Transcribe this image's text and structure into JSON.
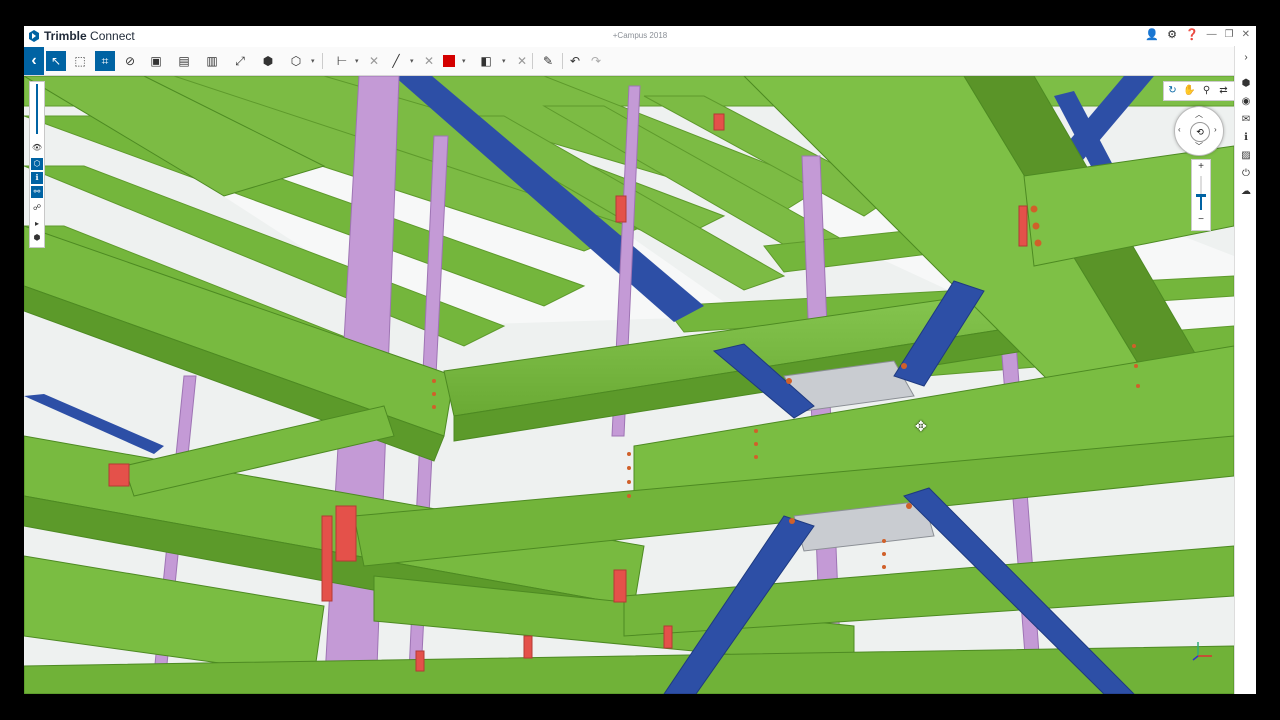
{
  "app": {
    "brand_bold": "Trimble",
    "brand_rest": " Connect",
    "document_title": "+Campus 2018"
  },
  "titlebar_icons": [
    "user-icon",
    "gear-icon",
    "help-icon",
    "minimize-icon",
    "restore-icon",
    "close-icon"
  ],
  "toolbar": {
    "tools": [
      {
        "name": "select-tool",
        "glyph": "↖",
        "active": true
      },
      {
        "name": "box-select-tool",
        "glyph": "⬚",
        "active": false
      },
      {
        "name": "multi-select-tool",
        "glyph": "⌗",
        "active": true
      },
      {
        "name": "hide-tool",
        "glyph": "◌",
        "active": false
      },
      {
        "name": "clip-plane-tool",
        "glyph": "▣",
        "active": false
      },
      {
        "name": "isolate-tool",
        "glyph": "▤",
        "active": false
      },
      {
        "name": "section-box-tool",
        "glyph": "▥",
        "active": false
      },
      {
        "name": "fit-view-tool",
        "glyph": "⤢",
        "active": false
      },
      {
        "name": "objects-tool",
        "glyph": "⬢",
        "active": false
      },
      {
        "name": "cube-view-tool",
        "glyph": "⬡",
        "active": false
      },
      {
        "name": "measure-tool",
        "glyph": "⊢",
        "active": false
      },
      {
        "name": "markup-line-tool",
        "glyph": "╱",
        "active": false
      },
      {
        "name": "color-tool",
        "glyph": "■",
        "active": false
      },
      {
        "name": "split-view-tool",
        "glyph": "◧",
        "active": false
      },
      {
        "name": "clear-markup-tool",
        "glyph": "✎",
        "active": false
      },
      {
        "name": "undo-tool",
        "glyph": "↶",
        "active": false
      },
      {
        "name": "redo-tool",
        "glyph": "↷",
        "active": false
      }
    ],
    "markup_color": "#d40000",
    "accent": "#0063a3"
  },
  "colors": {
    "beam_green": "#74b63c",
    "column_purple": "#c49ad6",
    "brace_blue": "#2d4fa6",
    "connection_red": "#e4514a",
    "plate_gray": "#c9ccd1"
  },
  "left_tools": [
    "scale-slider",
    "eye-icon",
    "layers-icon",
    "info-icon",
    "link-icon",
    "walk-icon",
    "play-icon",
    "cube-icon"
  ],
  "nav_tools": [
    "orbit-icon",
    "pan-icon",
    "walk-icon",
    "look-icon",
    "fullscreen-icon"
  ],
  "right_sidebar": [
    "chevron-right-icon",
    "objects-icon",
    "views-icon",
    "comments-icon",
    "info-icon",
    "image-icon",
    "power-icon",
    "cloud-icon"
  ],
  "zoom": {
    "plus": "+",
    "minus": "−",
    "level": 0.45
  }
}
